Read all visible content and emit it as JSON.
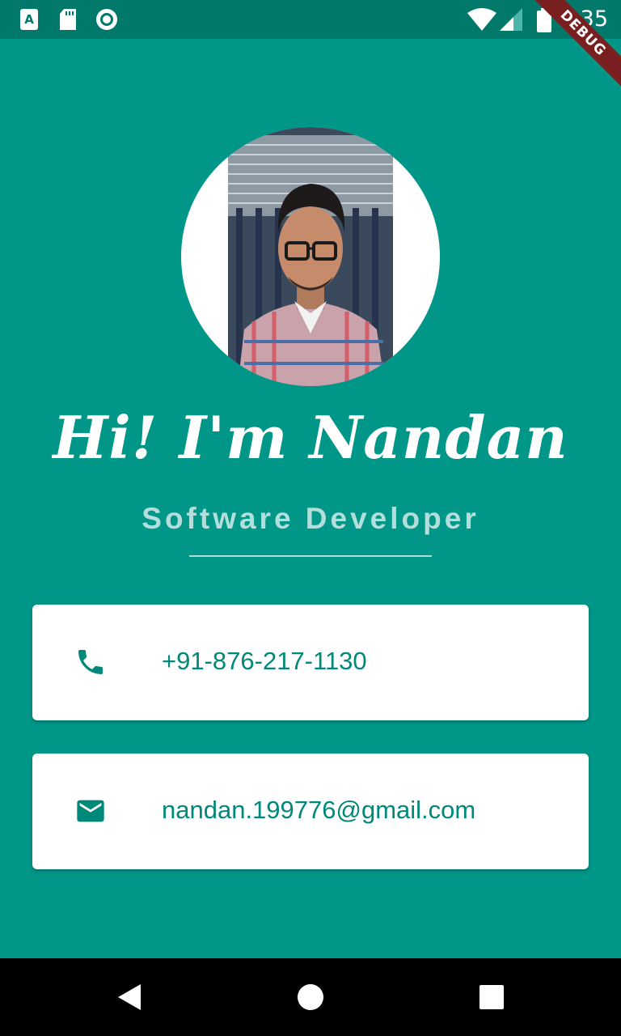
{
  "status_bar": {
    "time": "4:35",
    "icons": [
      "text-a-icon",
      "sd-card-icon",
      "record-icon",
      "wifi-icon",
      "signal-icon",
      "battery-icon"
    ]
  },
  "debug_banner": "DEBUG",
  "profile": {
    "name": "Hi! I'm Nandan",
    "role": "Software Developer"
  },
  "contacts": {
    "phone": "+91-876-217-1130",
    "email": "nandan.199776@gmail.com"
  },
  "navigation": [
    "back-icon",
    "home-icon",
    "recents-icon"
  ],
  "colors": {
    "background": "#009688",
    "status_bar": "#00796b",
    "accent_text": "#00897b",
    "subtitle": "#b2dfdb"
  }
}
